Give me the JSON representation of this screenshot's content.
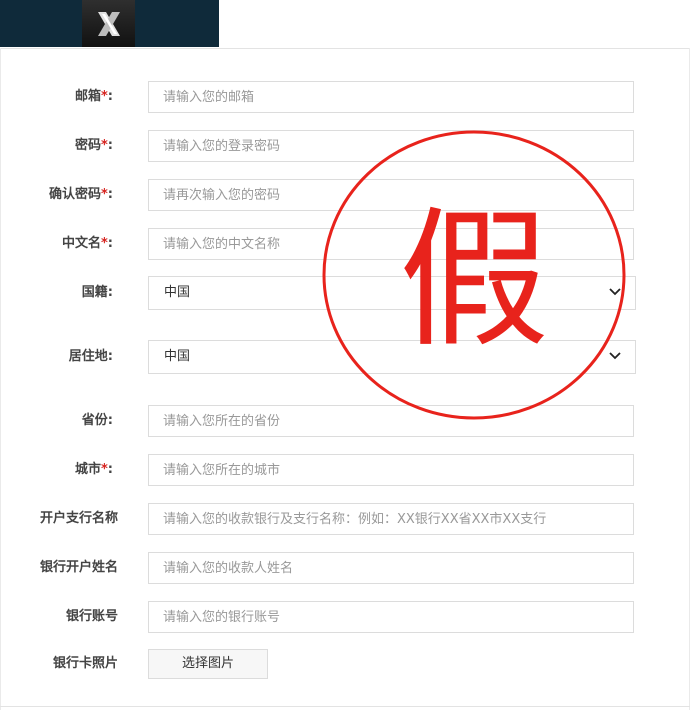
{
  "header": {
    "logo_icon": "x-logo-icon"
  },
  "form": {
    "email": {
      "label": "邮箱",
      "required_mark": "*",
      "colon": ":",
      "placeholder": "请输入您的邮箱"
    },
    "password": {
      "label": "密码",
      "required_mark": "*",
      "colon": ":",
      "placeholder": "请输入您的登录密码"
    },
    "confirm_password": {
      "label": "确认密码",
      "required_mark": "*",
      "colon": ":",
      "placeholder": "请再次输入您的密码"
    },
    "chinese_name": {
      "label": "中文名",
      "required_mark": "*",
      "colon": ":",
      "placeholder": "请输入您的中文名称"
    },
    "nationality": {
      "label": "国籍:",
      "value": "中国"
    },
    "residence": {
      "label": "居住地:",
      "value": "中国"
    },
    "province": {
      "label": "省份:",
      "placeholder": "请输入您所在的省份"
    },
    "city": {
      "label": "城市",
      "required_mark": "*",
      "colon": ":",
      "placeholder": "请输入您所在的城市"
    },
    "bank_branch": {
      "label": "开户支行名称",
      "placeholder": "请输入您的收款银行及支行名称：例如：XX银行XX省XX市XX支行"
    },
    "account_name": {
      "label": "银行开户姓名",
      "placeholder": "请输入您的收款人姓名"
    },
    "account_number": {
      "label": "银行账号",
      "placeholder": "请输入您的银行账号"
    },
    "card_photo": {
      "label": "银行卡照片",
      "button": "选择图片"
    }
  },
  "stamp": {
    "text": "假",
    "color": "#e8231c"
  },
  "colors": {
    "header_bg": "#0f2a3a",
    "required": "#d6231f"
  }
}
